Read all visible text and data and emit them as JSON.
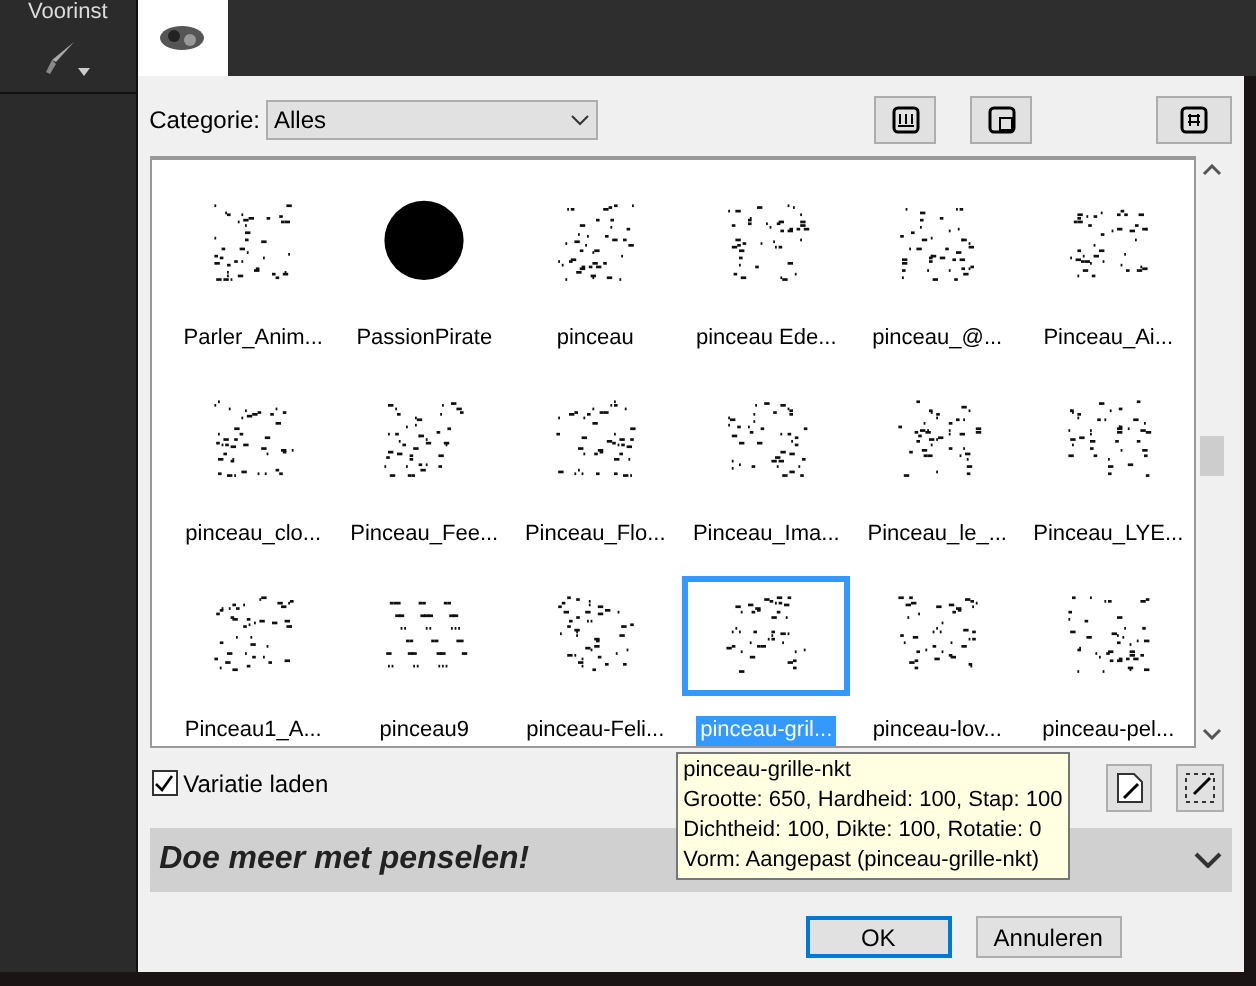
{
  "left_panel": {
    "label": "Voorinst"
  },
  "tabs": [
    {
      "selected": true
    }
  ],
  "category": {
    "label": "Categorie:",
    "value": "Alles"
  },
  "brushes": [
    {
      "label": "Parler_Anim...",
      "selected": false
    },
    {
      "label": "PassionPirate",
      "selected": false
    },
    {
      "label": "pinceau",
      "selected": false
    },
    {
      "label": "pinceau Ede...",
      "selected": false
    },
    {
      "label": "pinceau_@...",
      "selected": false
    },
    {
      "label": "Pinceau_Ai...",
      "selected": false
    },
    {
      "label": "pinceau_clo...",
      "selected": false
    },
    {
      "label": "Pinceau_Fee...",
      "selected": false
    },
    {
      "label": "Pinceau_Flo...",
      "selected": false
    },
    {
      "label": "Pinceau_Ima...",
      "selected": false
    },
    {
      "label": "Pinceau_le_...",
      "selected": false
    },
    {
      "label": "Pinceau_LYE...",
      "selected": false
    },
    {
      "label": "Pinceau1_A...",
      "selected": false
    },
    {
      "label": "pinceau9",
      "selected": false
    },
    {
      "label": "pinceau-Feli...",
      "selected": false
    },
    {
      "label": "pinceau-gril...",
      "selected": true
    },
    {
      "label": "pinceau-lov...",
      "selected": false
    },
    {
      "label": "pinceau-pel...",
      "selected": false
    }
  ],
  "variatie": {
    "label": "Variatie laden",
    "checked": true
  },
  "tooltip": [
    "pinceau-grille-nkt",
    "Grootte: 650, Hardheid: 100, Stap: 100",
    "Dichtheid: 100, Dikte: 100, Rotatie: 0",
    "Vorm: Aangepast (pinceau-grille-nkt)"
  ],
  "banner": {
    "title": "Doe meer met penselen!",
    "expanded": false
  },
  "buttons": [
    "OK",
    "Annuleren"
  ]
}
